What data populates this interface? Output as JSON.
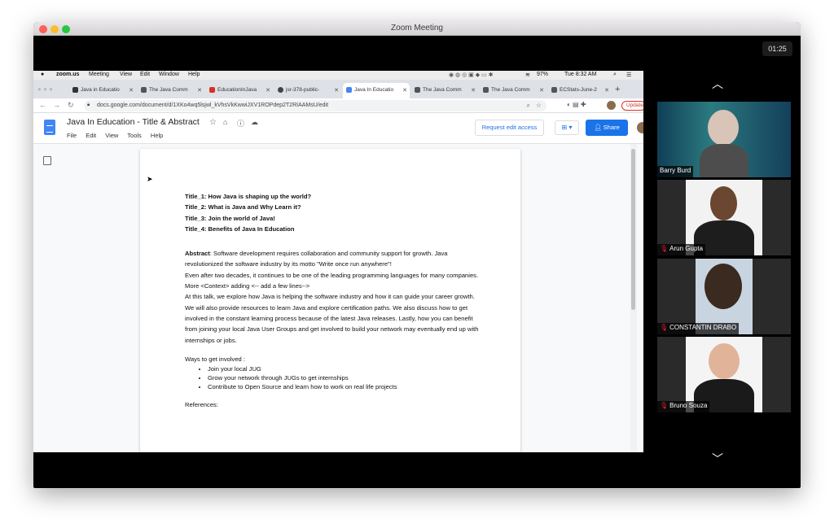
{
  "window": {
    "title": "Zoom Meeting",
    "timer": "01:25"
  },
  "mac_menubar": {
    "app": "zoom.us",
    "menus": [
      "Meeting",
      "View",
      "Edit",
      "Window",
      "Help"
    ],
    "battery": "97%",
    "clock": "Tue 8:32 AM"
  },
  "browser": {
    "tabs": [
      {
        "label": "Java in Educatio",
        "color": "#333333"
      },
      {
        "label": "The Java Comm",
        "color": "#555555"
      },
      {
        "label": "EducationInJava",
        "color": "#d93025"
      },
      {
        "label": "jsr-378-public-",
        "color": "#444444"
      },
      {
        "label": "Java In Educatio",
        "color": "#4285f4",
        "active": true
      },
      {
        "label": "The Java Comm",
        "color": "#555555"
      },
      {
        "label": "The Java Comm",
        "color": "#555555"
      },
      {
        "label": "ECStats-June-2",
        "color": "#555555"
      }
    ],
    "url": "docs.google.com/document/d/1XKo4wq5lsjwl_kVhsVkKwwiJXV1ROPdep2T2RIAAMsU/edit",
    "update_label": "Update"
  },
  "docs": {
    "title": "Java In Education - Title & Abstract",
    "menus": [
      "File",
      "Edit",
      "View",
      "Tools",
      "Help"
    ],
    "request_edit": "Request edit access",
    "share_label": "Share"
  },
  "document": {
    "titles": [
      "Title_1: How Java is shaping up the world?",
      "Title_2: What is Java and Why Learn it?",
      "Title_3: Join the world of Java!",
      "Title_4: Benefits of Java In Education"
    ],
    "abstract_label": "Abstract",
    "abstract_lines": [
      ": Software development requires collaboration and community support for growth. Java revolutionized the software industry by its motto \"Write once run anywhere\"!",
      "Even after two decades, it continues to be one of the leading programming languages for many companies.",
      "More <Context> adding <-- add a few lines-->",
      "At this talk, we explore how Java is helping the software industry and how it can guide your career growth. We will also provide resources to learn Java and explore certification paths. We also discuss how to get involved in the constant learning process because of the latest Java releases. Lastly, how you can benefit from joining your local Java User Groups and get involved to build your network may eventually end up with internships or jobs."
    ],
    "ways_heading": "Ways to get involved :",
    "ways": [
      "Join your local JUG",
      "Grow your network through JUGs to get internships",
      "Contribute to Open Source and learn how to work on real life projects"
    ],
    "references": "References:"
  },
  "participants": [
    {
      "name": "Barry Burd",
      "muted": false
    },
    {
      "name": "Arun Gupta",
      "muted": true
    },
    {
      "name": "CONSTANTIN DRABO",
      "muted": true
    },
    {
      "name": "Bruno Souza",
      "muted": true
    }
  ],
  "colors": {
    "share_button": "#1a73e8",
    "mute_icon": "#e0242a"
  }
}
